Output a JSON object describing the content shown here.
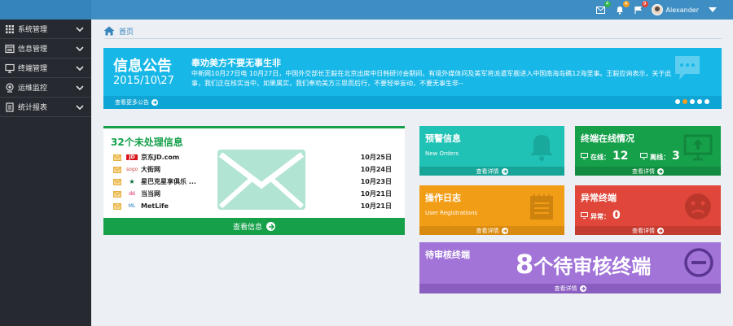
{
  "topbar": {
    "mail_badge": "4",
    "bell_badge": "4",
    "flag_badge": "9",
    "user_name": "Alexander",
    "colors": {
      "mail_badge": "#2db34a",
      "bell_badge": "#f0a020",
      "flag_badge": "#e0473a"
    }
  },
  "sidebar": {
    "items": [
      {
        "label": "系统管理",
        "icon": "grid-icon"
      },
      {
        "label": "信息管理",
        "icon": "list-icon"
      },
      {
        "label": "终端管理",
        "icon": "monitor-icon"
      },
      {
        "label": "运维监控",
        "icon": "eye-icon"
      },
      {
        "label": "统计报表",
        "icon": "report-icon"
      }
    ]
  },
  "breadcrumb": {
    "home": "首页"
  },
  "announcement": {
    "label": "信息公告",
    "date": "2015/10\\27",
    "title": "奉劝美方不要无事生非",
    "body": "中新网10月27日电 10月27日，中国外交部长王毅在北京出席中日韩研讨会期间，有境外媒体问及美军将派遣军舰进入中国南海岛礁12海里事。王毅应询表示，关于此事，我们正在核实当中，如果属实，我们奉劝美方三思而后行，不要轻举妄动，不要无事生非-- ",
    "more": "查看更多公告",
    "dots_active": 1
  },
  "unprocessed": {
    "heading": "32个未处理信息",
    "rows": [
      {
        "logo": "JD",
        "name": "京东JD.com",
        "date": "10月25日"
      },
      {
        "logo": "sogo",
        "name": "大街网",
        "date": "10月24日"
      },
      {
        "logo": "★",
        "name": "星巴克星享俱乐 ...",
        "date": "10月23日"
      },
      {
        "logo": "dd",
        "name": "当当网",
        "date": "10月21日"
      },
      {
        "logo": "ML",
        "name": "MetLife",
        "date": "10月21日"
      }
    ],
    "footer": "查看信息"
  },
  "tiles": {
    "alert": {
      "title": "预警信息",
      "sub": "New Orders",
      "footer": "查看详情"
    },
    "online": {
      "title": "终端在线情况",
      "online_label": "在线：",
      "online_value": "12",
      "offline_label": "离线：",
      "offline_value": "3",
      "footer": "查看详情"
    },
    "log": {
      "title": "操作日志",
      "sub": "User Registrations",
      "footer": "查看详情"
    },
    "abnormal": {
      "title": "异常终端",
      "label": "异常：",
      "value": "0",
      "footer": "查看详情"
    },
    "pending": {
      "title": "待审核终端",
      "num": "8",
      "text": "个待审核终端",
      "footer": "查看详情"
    }
  }
}
